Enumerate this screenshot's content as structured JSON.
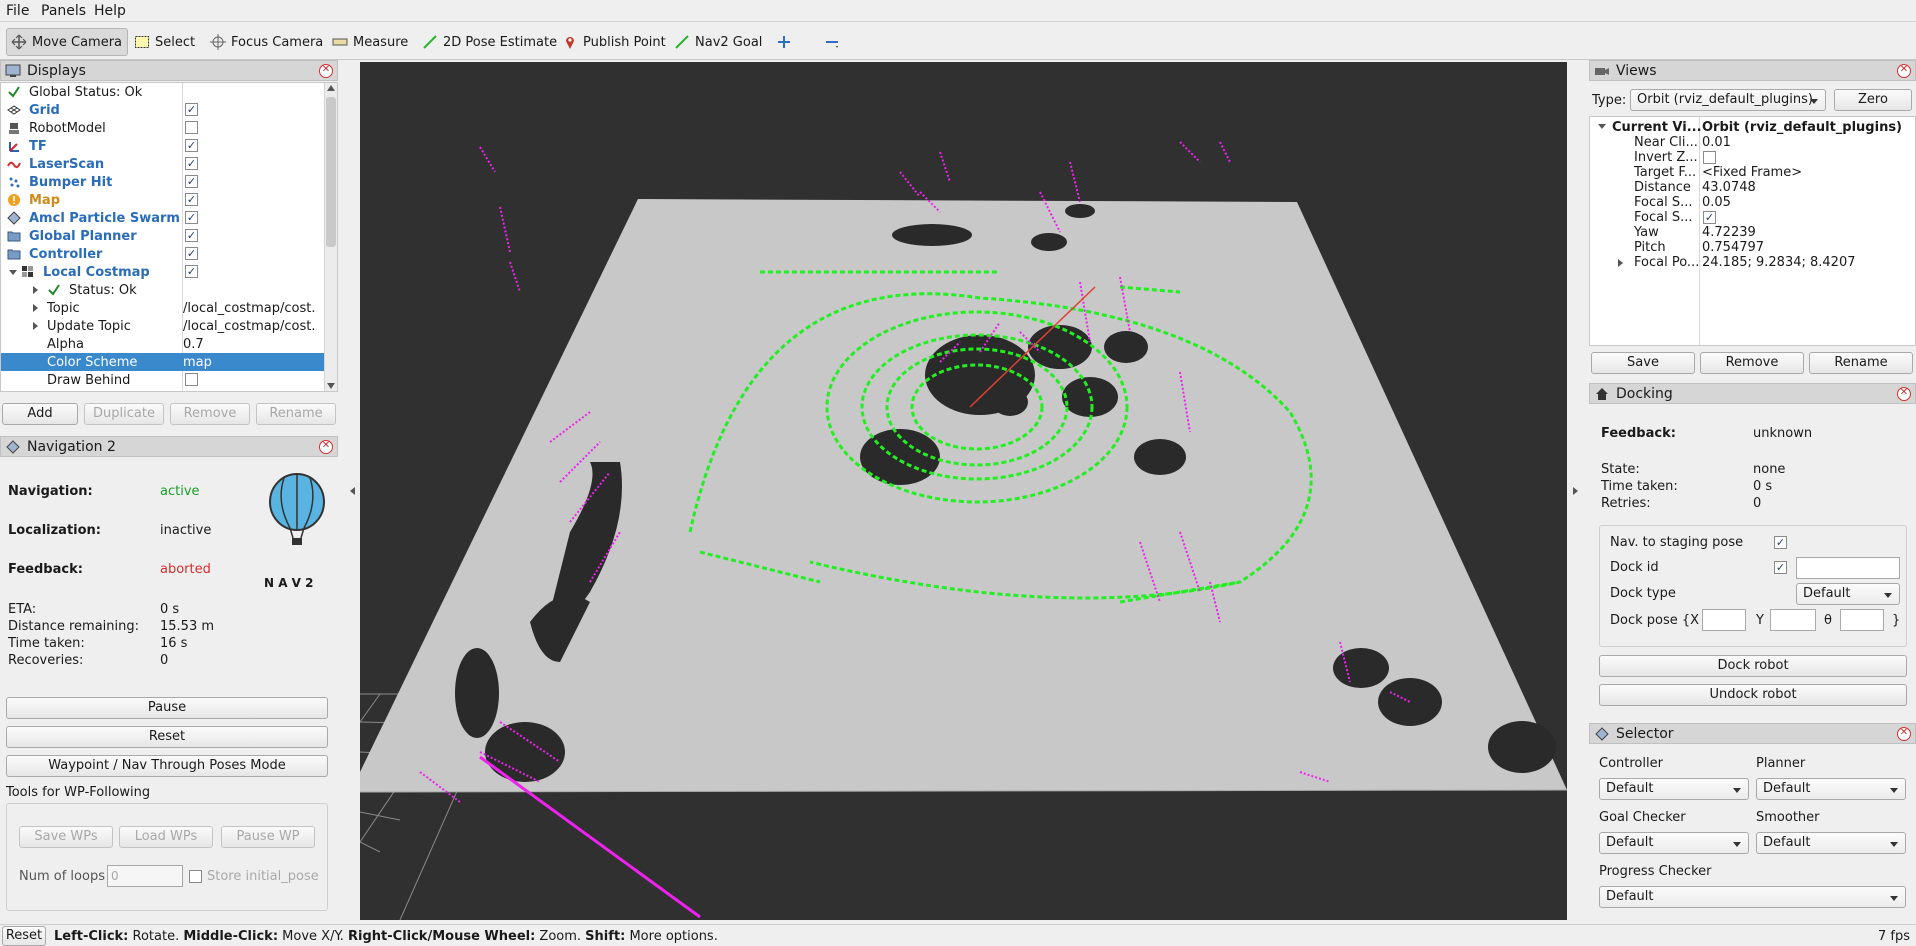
{
  "menu": [
    "File",
    "Panels",
    "Help"
  ],
  "toolbar": {
    "tools": [
      {
        "label": "Move Camera",
        "icon": "move-camera-icon"
      },
      {
        "label": "Select",
        "icon": "select-icon"
      },
      {
        "label": "Focus Camera",
        "icon": "focus-camera-icon"
      },
      {
        "label": "Measure",
        "icon": "measure-icon"
      },
      {
        "label": "2D Pose Estimate",
        "icon": "pose-estimate-icon"
      },
      {
        "label": "Publish Point",
        "icon": "publish-point-icon"
      },
      {
        "label": "Nav2 Goal",
        "icon": "nav2-goal-icon"
      }
    ],
    "add_icon": "plus-icon",
    "remove_icon": "minus-icon"
  },
  "displays": {
    "title": "Displays",
    "items": [
      {
        "label": "Global Status: Ok",
        "style": "plain",
        "icon": "check-icon",
        "checked": null
      },
      {
        "label": "Grid",
        "style": "blue",
        "icon": "grid-icon",
        "checked": true
      },
      {
        "label": "RobotModel",
        "style": "plain",
        "icon": "robot-icon",
        "checked": false
      },
      {
        "label": "TF",
        "style": "blue",
        "icon": "tf-icon",
        "checked": true
      },
      {
        "label": "LaserScan",
        "style": "blue",
        "icon": "laser-icon",
        "checked": true
      },
      {
        "label": "Bumper Hit",
        "style": "blue",
        "icon": "bumper-icon",
        "checked": true
      },
      {
        "label": "Map",
        "style": "orange",
        "icon": "warning-icon",
        "checked": true
      },
      {
        "label": "Amcl Particle Swarm",
        "style": "blue",
        "icon": "particle-icon",
        "checked": true
      },
      {
        "label": "Global Planner",
        "style": "blue",
        "icon": "folder-icon",
        "checked": true
      },
      {
        "label": "Controller",
        "style": "blue",
        "icon": "folder-icon",
        "checked": true
      },
      {
        "label": "Local Costmap",
        "style": "blue",
        "icon": "costmap-icon",
        "checked": true
      }
    ],
    "props": [
      {
        "label": "Status: Ok",
        "value": ""
      },
      {
        "label": "Topic",
        "value": "/local_costmap/cost..."
      },
      {
        "label": "Update Topic",
        "value": "/local_costmap/cost..."
      },
      {
        "label": "Alpha",
        "value": "0.7"
      },
      {
        "label": "Color Scheme",
        "value": "map"
      },
      {
        "label": "Draw Behind",
        "value": ""
      }
    ],
    "buttons": {
      "add": "Add",
      "duplicate": "Duplicate",
      "remove": "Remove",
      "rename": "Rename"
    }
  },
  "nav2": {
    "title": "Navigation 2",
    "navigation_label": "Navigation:",
    "navigation_value": "active",
    "localization_label": "Localization:",
    "localization_value": "inactive",
    "feedback_label": "Feedback:",
    "feedback_value": "aborted",
    "logo_text": "N A V 2",
    "eta_label": "ETA:",
    "eta_value": "0 s",
    "distance_label": "Distance remaining:",
    "distance_value": "15.53 m",
    "time_label": "Time taken:",
    "time_value": "16 s",
    "recoveries_label": "Recoveries:",
    "recoveries_value": "0",
    "pause": "Pause",
    "reset": "Reset",
    "waypoint_mode": "Waypoint / Nav Through Poses Mode",
    "tools_title": "Tools for WP-Following",
    "save_wps": "Save WPs",
    "load_wps": "Load WPs",
    "pause_wp": "Pause WP",
    "loops_label": "Num of loops",
    "loops_value": "0",
    "store_initial": "Store initial_pose",
    "colors": {
      "active": "#1e9c2a",
      "aborted": "#d32f2f"
    }
  },
  "views": {
    "title": "Views",
    "type_label": "Type:",
    "type_value": "Orbit (rviz_default_plugins)",
    "zero": "Zero",
    "current_label": "Current Vi...",
    "current_value": "Orbit (rviz_default_plugins)",
    "props": [
      {
        "label": "Near Cli...",
        "value": "0.01"
      },
      {
        "label": "Invert Z...",
        "value": ""
      },
      {
        "label": "Target F...",
        "value": "<Fixed Frame>"
      },
      {
        "label": "Distance",
        "value": "43.0748"
      },
      {
        "label": "Focal S...",
        "value": "0.05"
      },
      {
        "label": "Focal S...",
        "value": ""
      },
      {
        "label": "Yaw",
        "value": "4.72239"
      },
      {
        "label": "Pitch",
        "value": "0.754797"
      },
      {
        "label": "Focal Po...",
        "value": "24.185; 9.2834; 8.4207"
      }
    ],
    "save": "Save",
    "remove": "Remove",
    "rename": "Rename"
  },
  "docking": {
    "title": "Docking",
    "feedback_label": "Feedback:",
    "feedback_value": "unknown",
    "state_label": "State:",
    "state_value": "none",
    "time_label": "Time taken:",
    "time_value": "0 s",
    "retries_label": "Retries:",
    "retries_value": "0",
    "staging_label": "Nav. to staging pose",
    "dock_id_label": "Dock id",
    "dock_type_label": "Dock type",
    "dock_type_value": "Default",
    "dock_pose_label": "Dock pose {X",
    "y_label": "Y",
    "theta_label": "θ",
    "close_brace": "}",
    "dock_btn": "Dock robot",
    "undock_btn": "Undock robot"
  },
  "selector": {
    "title": "Selector",
    "controller_label": "Controller",
    "controller_value": "Default",
    "planner_label": "Planner",
    "planner_value": "Default",
    "goal_label": "Goal Checker",
    "goal_value": "Default",
    "smoother_label": "Smoother",
    "smoother_value": "Default",
    "progress_label": "Progress Checker",
    "progress_value": "Default"
  },
  "status": {
    "reset": "Reset",
    "k1": "Left-Click:",
    "t1": " Rotate. ",
    "k2": "Middle-Click:",
    "t2": " Move X/Y. ",
    "k3": "Right-Click/Mouse Wheel:",
    "t3": " Zoom. ",
    "k4": "Shift:",
    "t4": " More options.",
    "fps": "7 fps"
  },
  "colors": {
    "laser": "#ee22ee",
    "path": "#22ee22",
    "map_floor": "#c8c8c8",
    "selection": "#3a89cc",
    "link_blue": "#2b6cb8",
    "map_orange": "#d08a18"
  }
}
